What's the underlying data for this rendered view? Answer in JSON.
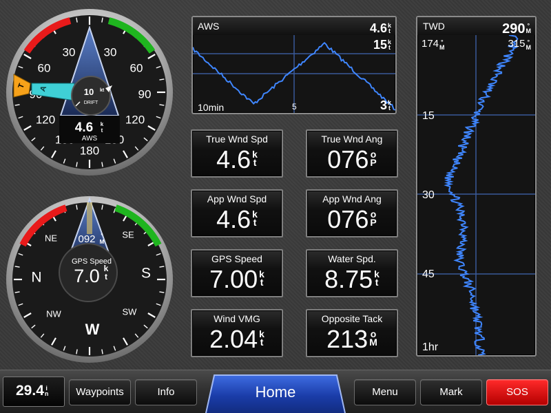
{
  "wind_gauge": {
    "labels_left": [
      "30",
      "60",
      "90",
      "120",
      "150"
    ],
    "labels_right": [
      "30",
      "60",
      "90",
      "120",
      "150"
    ],
    "label_bottom": "180",
    "drift_value": "10",
    "drift_unit": "kt",
    "drift_label": "DRIFT",
    "speed_value": "4.6",
    "speed_unit_top": "k",
    "speed_unit_bottom": "t",
    "speed_label": "AWS",
    "pointer_A": "A",
    "pointer_T": "T",
    "colors": {
      "port": "#e81a1a",
      "starboard": "#1fb51f",
      "true_wind": "#f7a21a",
      "apparent_wind": "#3fd0d6"
    }
  },
  "compass_gauge": {
    "cardinals": {
      "north": "N",
      "south": "S",
      "west": "W"
    },
    "intercardinals": {
      "ne": "NE",
      "se": "SE",
      "sw": "SW",
      "nw": "NW"
    },
    "heading_value": "092",
    "heading_unit_top": "°",
    "heading_unit_bottom": "M",
    "gps_label": "GPS Speed",
    "gps_value": "7.0",
    "gps_unit_top": "k",
    "gps_unit_bottom": "t"
  },
  "aws_graph": {
    "title": "AWS",
    "current_value": "4.6",
    "max_value": "15",
    "min_value": "3",
    "unit_top": "k",
    "unit_bottom": "t",
    "time_start": "10min",
    "time_mid": "5"
  },
  "twd_graph": {
    "title": "TWD",
    "current_value": "290",
    "left_value": "174",
    "right_value": "315",
    "unit_top": "°",
    "unit_bottom": "M",
    "time_labels": [
      "15",
      "30",
      "45",
      "1hr"
    ]
  },
  "tiles": [
    {
      "label": "True Wnd Spd",
      "value": "4.6",
      "unit_top": "k",
      "unit_bottom": "t"
    },
    {
      "label": "True Wnd Ang",
      "value": "076",
      "unit_top": "o",
      "unit_bottom": "P"
    },
    {
      "label": "App Wnd Spd",
      "value": "4.6",
      "unit_top": "k",
      "unit_bottom": "t"
    },
    {
      "label": "App Wnd Ang",
      "value": "076",
      "unit_top": "o",
      "unit_bottom": "P"
    },
    {
      "label": "GPS Speed",
      "value": "7.00",
      "unit_top": "k",
      "unit_bottom": "t"
    },
    {
      "label": "Water Spd.",
      "value": "8.75",
      "unit_top": "k",
      "unit_bottom": "t"
    },
    {
      "label": "Wind VMG",
      "value": "2.04",
      "unit_top": "k",
      "unit_bottom": "t"
    },
    {
      "label": "Opposite Tack",
      "value": "213",
      "unit_top": "o",
      "unit_bottom": "M"
    }
  ],
  "bottom_bar": {
    "barometer_value": "29.4",
    "barometer_unit_top": "i",
    "barometer_unit_bottom": "n",
    "waypoints": "Waypoints",
    "info": "Info",
    "home": "Home",
    "menu": "Menu",
    "mark": "Mark",
    "sos": "SOS",
    "colors": {
      "home": "#1f45c0",
      "sos": "#e00000"
    }
  }
}
